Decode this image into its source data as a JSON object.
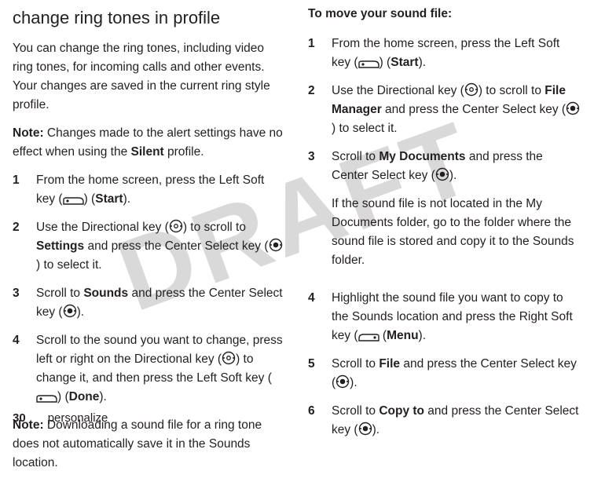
{
  "watermark": "DRAFT",
  "left": {
    "heading": "change ring tones in profile",
    "intro": "You can change the ring tones, including video ring tones, for incoming calls and other events. Your changes are saved in the current ring style profile.",
    "note1_label": "Note:",
    "note1_a": " Changes made to the alert settings have no effect when using the ",
    "note1_silent": "Silent",
    "note1_b": " profile.",
    "s1_a": "From the home screen, press the Left Soft key (",
    "s1_b": ") (",
    "s1_start": "Start",
    "s1_c": ").",
    "s2_a": "Use the Directional key (",
    "s2_b": ") to scroll to ",
    "s2_settings": "Settings",
    "s2_c": " and press the Center Select key (",
    "s2_d": ") to select it.",
    "s3_a": "Scroll to ",
    "s3_sounds": "Sounds",
    "s3_b": " and press the Center Select key (",
    "s3_c": ").",
    "s4_a": "Scroll to the sound you want to change, press left or right on the Directional key (",
    "s4_b": ") to change it, and then press the Left Soft key (",
    "s4_c": ") (",
    "s4_done": "Done",
    "s4_d": ").",
    "note2_label": "Note:",
    "note2_a": " Downloading a sound file for a ring tone does not automatically save it in the Sounds location."
  },
  "right": {
    "heading": "To move your sound file:",
    "s1_a": "From the home screen, press the Left Soft key (",
    "s1_b": ") (",
    "s1_start": "Start",
    "s1_c": ").",
    "s2_a": "Use the Directional key (",
    "s2_b": ") to scroll to ",
    "s2_fm": "File Manager",
    "s2_c": " and press the Center Select key (",
    "s2_d": ") to select it.",
    "s3_a": "Scroll to ",
    "s3_mydocs": "My Documents",
    "s3_b": " and press the Center Select key (",
    "s3_c": ").",
    "s3_extra": "If the sound file is not located in the My Documents folder, go to the folder where the sound file is stored and copy it to the Sounds folder.",
    "s4_a": "Highlight the sound file you want to copy to the Sounds location and press the Right Soft key (",
    "s4_b": " (",
    "s4_menu": "Menu",
    "s4_c": ").",
    "s5_a": "Scroll to ",
    "s5_file": "File",
    "s5_b": " and press the Center Select key (",
    "s5_c": ").",
    "s6_a": "Scroll to  ",
    "s6_copyto": "Copy to",
    "s6_b": " and press the Center Select key (",
    "s6_c": ")."
  },
  "footer": {
    "page_num": "30",
    "section": "personalize"
  }
}
